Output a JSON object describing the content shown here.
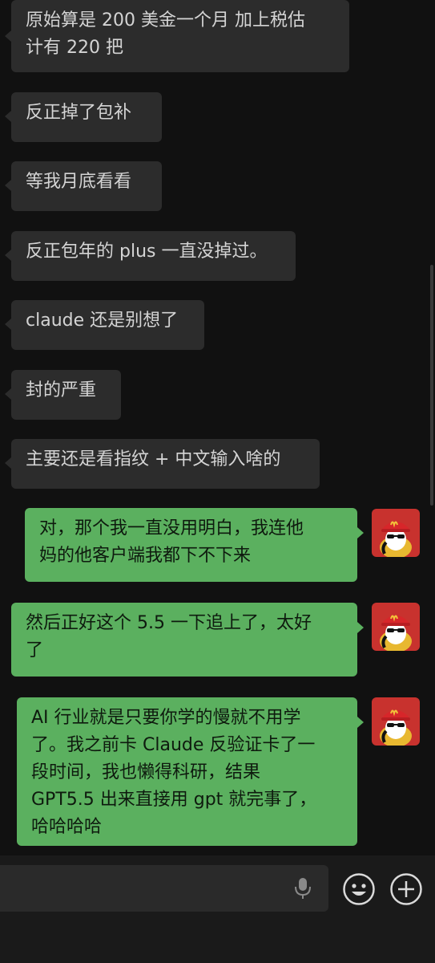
{
  "messages": [
    {
      "side": "in",
      "lines": [
        "原始算是 200 美金一个月 加上税估",
        "计有 220 把"
      ]
    },
    {
      "side": "in",
      "lines": [
        "反正掉了包补"
      ]
    },
    {
      "side": "in",
      "lines": [
        "等我月底看看"
      ]
    },
    {
      "side": "in",
      "lines": [
        "反正包年的 plus 一直没掉过。"
      ]
    },
    {
      "side": "in",
      "lines": [
        "claude 还是别想了"
      ]
    },
    {
      "side": "in",
      "lines": [
        "封的严重"
      ]
    },
    {
      "side": "in",
      "lines": [
        "主要还是看指纹 + 中文输入啥的"
      ]
    },
    {
      "side": "out",
      "lines": [
        "对，那个我一直没用明白，我连他",
        "妈的他客户端我都下不下来"
      ]
    },
    {
      "side": "out",
      "lines": [
        "然后正好这个 5.5 一下追上了，太好",
        "了"
      ]
    },
    {
      "side": "out",
      "lines": [
        "AI 行业就是只要你学的慢就不用学",
        "了。我之前卡 Claude 反验证卡了一",
        "段时间，我也懒得科研，结果",
        "GPT5.5 出来直接用 gpt 就完事了，",
        "哈哈哈哈"
      ]
    }
  ],
  "colors": {
    "incoming": "#2c2c2c",
    "outgoing": "#5bb05f",
    "background": "#111111"
  },
  "icons": {
    "voice": "microphone-icon",
    "emoji": "emoji-icon",
    "more": "plus-icon"
  }
}
